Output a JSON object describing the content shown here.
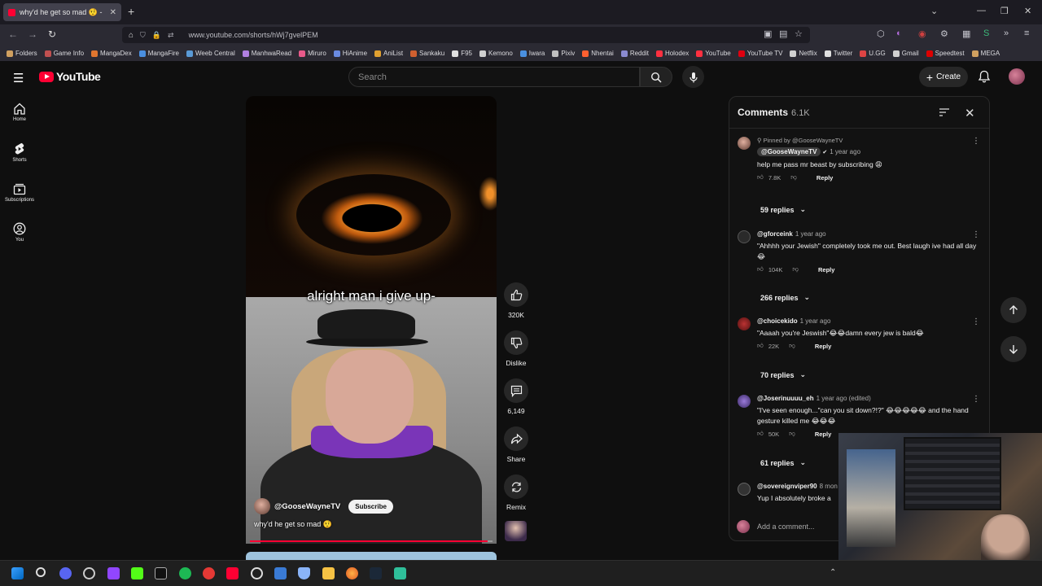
{
  "browser": {
    "tab_title": "why'd he get so mad 🤨 -",
    "url": "www.youtube.com/shorts/hWj7gvelPEM",
    "bookmarks": [
      "Folders",
      "Game Info",
      "MangaDex",
      "MangaFire",
      "Weeb Central",
      "ManhwaRead",
      "Miruro",
      "HiAnime",
      "AniList",
      "Sankaku",
      "F95",
      "Kemono",
      "Iwara",
      "Pixiv",
      "Nhentai",
      "Reddit",
      "Holodex",
      "YouTube",
      "YouTube TV",
      "Netflix",
      "Twitter",
      "U.GG",
      "Gmail",
      "Speedtest",
      "MEGA"
    ]
  },
  "header": {
    "logo_text": "YouTube",
    "search_placeholder": "Search",
    "create_label": "Create"
  },
  "leftnav": {
    "items": [
      {
        "label": "Home",
        "icon": "home-icon"
      },
      {
        "label": "Shorts",
        "icon": "shorts-icon"
      },
      {
        "label": "Subscriptions",
        "icon": "subscriptions-icon"
      },
      {
        "label": "You",
        "icon": "you-icon"
      }
    ]
  },
  "video": {
    "caption": "alright man i give up-",
    "channel": "@GooseWayneTV",
    "subscribe_label": "Subscribe",
    "title": "why'd he get so mad 🤨",
    "progress": 0.98
  },
  "actions": {
    "likes": "320K",
    "dislike_label": "Dislike",
    "comments": "6,149",
    "share_label": "Share",
    "remix_label": "Remix"
  },
  "comments": {
    "title": "Comments",
    "count": "6.1K",
    "add_placeholder": "Add a comment...",
    "reply_label": "Reply",
    "items": [
      {
        "pinned": "Pinned by @GooseWayneTV",
        "author": "@GooseWayneTV",
        "time": "1 year ago",
        "text": "help me pass mr beast by subscribing 😩",
        "likes": "7.8K",
        "replies": "59 replies"
      },
      {
        "author": "@gforceink",
        "time": "1 year ago",
        "text": "\"Ahhhh your Jewish\" completely took me out.  Best laugh ive had all day 😂",
        "likes": "104K",
        "replies": "266 replies"
      },
      {
        "author": "@choicekido",
        "time": "1 year ago",
        "text": "\"Aaaah you're Jeswish\"😂😂damn every jew is bald😂",
        "likes": "22K",
        "replies": "70 replies"
      },
      {
        "author": "@Joserinuuuu_eh",
        "time": "1 year ago (edited)",
        "text": "\"I've seen enough...\"can you sit down?!?\" 😂😂😂😂😂 and the hand gesture killed me 😂😂😂",
        "likes": "50K",
        "replies": "61 replies"
      },
      {
        "author": "@sovereignviper90",
        "time": "8 mon",
        "text": "Yup I absolutely broke a"
      }
    ]
  },
  "colors": {
    "accent": "#ff0033",
    "background": "#0f0f0f",
    "panel": "#121212"
  }
}
